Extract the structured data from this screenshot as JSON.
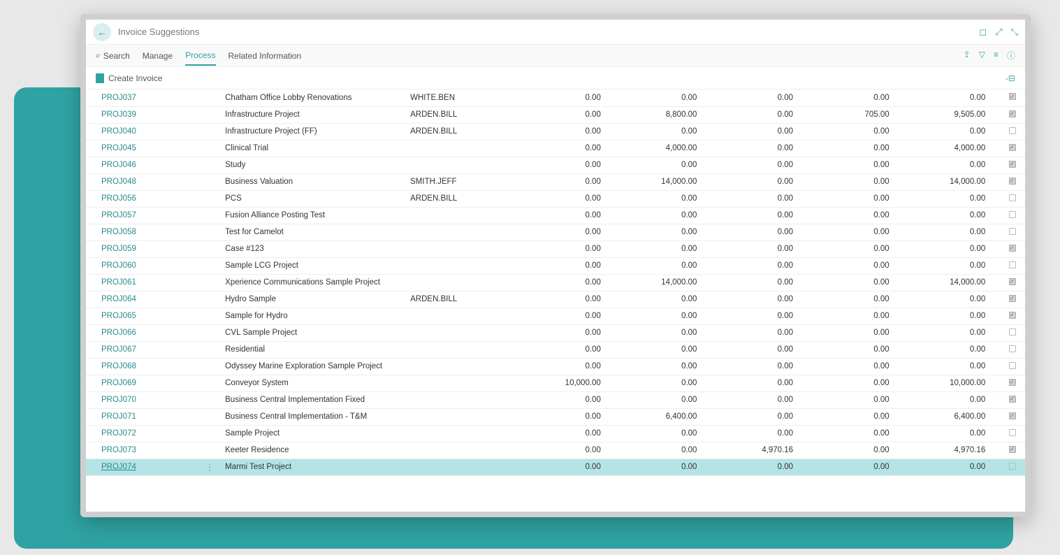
{
  "header": {
    "title": "Invoice Suggestions"
  },
  "menubar": {
    "search": "Search",
    "items": [
      "Manage",
      "Process",
      "Related Information"
    ],
    "active_index": 1
  },
  "actionbar": {
    "create_invoice": "Create Invoice"
  },
  "table": {
    "rows": [
      {
        "proj": "PROJ037",
        "desc": "Chatham Office Lobby Renovations",
        "owner": "WHITE.BEN",
        "c1": "0.00",
        "c2": "0.00",
        "c3": "0.00",
        "c4": "0.00",
        "c5": "0.00",
        "chk": true
      },
      {
        "proj": "PROJ039",
        "desc": "Infrastructure Project",
        "owner": "ARDEN.BILL",
        "c1": "0.00",
        "c2": "8,800.00",
        "c3": "0.00",
        "c4": "705.00",
        "c5": "9,505.00",
        "chk": true
      },
      {
        "proj": "PROJ040",
        "desc": "Infrastructure Project (FF)",
        "owner": "ARDEN.BILL",
        "c1": "0.00",
        "c2": "0.00",
        "c3": "0.00",
        "c4": "0.00",
        "c5": "0.00",
        "chk": false
      },
      {
        "proj": "PROJ045",
        "desc": "Clinical Trial",
        "owner": "",
        "c1": "0.00",
        "c2": "4,000.00",
        "c3": "0.00",
        "c4": "0.00",
        "c5": "4,000.00",
        "chk": true
      },
      {
        "proj": "PROJ046",
        "desc": "Study",
        "owner": "",
        "c1": "0.00",
        "c2": "0.00",
        "c3": "0.00",
        "c4": "0.00",
        "c5": "0.00",
        "chk": true
      },
      {
        "proj": "PROJ048",
        "desc": "Business Valuation",
        "owner": "SMITH.JEFF",
        "c1": "0.00",
        "c2": "14,000.00",
        "c3": "0.00",
        "c4": "0.00",
        "c5": "14,000.00",
        "chk": true
      },
      {
        "proj": "PROJ056",
        "desc": "PCS",
        "owner": "ARDEN.BILL",
        "c1": "0.00",
        "c2": "0.00",
        "c3": "0.00",
        "c4": "0.00",
        "c5": "0.00",
        "chk": false
      },
      {
        "proj": "PROJ057",
        "desc": "Fusion Alliance Posting Test",
        "owner": "",
        "c1": "0.00",
        "c2": "0.00",
        "c3": "0.00",
        "c4": "0.00",
        "c5": "0.00",
        "chk": false
      },
      {
        "proj": "PROJ058",
        "desc": "Test for Camelot",
        "owner": "",
        "c1": "0.00",
        "c2": "0.00",
        "c3": "0.00",
        "c4": "0.00",
        "c5": "0.00",
        "chk": false
      },
      {
        "proj": "PROJ059",
        "desc": "Case #123",
        "owner": "",
        "c1": "0.00",
        "c2": "0.00",
        "c3": "0.00",
        "c4": "0.00",
        "c5": "0.00",
        "chk": true
      },
      {
        "proj": "PROJ060",
        "desc": "Sample LCG Project",
        "owner": "",
        "c1": "0.00",
        "c2": "0.00",
        "c3": "0.00",
        "c4": "0.00",
        "c5": "0.00",
        "chk": false
      },
      {
        "proj": "PROJ061",
        "desc": "Xperience Communications Sample Project",
        "owner": "",
        "c1": "0.00",
        "c2": "14,000.00",
        "c3": "0.00",
        "c4": "0.00",
        "c5": "14,000.00",
        "chk": true
      },
      {
        "proj": "PROJ064",
        "desc": "Hydro Sample",
        "owner": "ARDEN.BILL",
        "c1": "0.00",
        "c2": "0.00",
        "c3": "0.00",
        "c4": "0.00",
        "c5": "0.00",
        "chk": true
      },
      {
        "proj": "PROJ065",
        "desc": "Sample for Hydro",
        "owner": "",
        "c1": "0.00",
        "c2": "0.00",
        "c3": "0.00",
        "c4": "0.00",
        "c5": "0.00",
        "chk": true
      },
      {
        "proj": "PROJ066",
        "desc": "CVL Sample Project",
        "owner": "",
        "c1": "0.00",
        "c2": "0.00",
        "c3": "0.00",
        "c4": "0.00",
        "c5": "0.00",
        "chk": false
      },
      {
        "proj": "PROJ067",
        "desc": "Residential",
        "owner": "",
        "c1": "0.00",
        "c2": "0.00",
        "c3": "0.00",
        "c4": "0.00",
        "c5": "0.00",
        "chk": false
      },
      {
        "proj": "PROJ068",
        "desc": "Odyssey Marine Exploration Sample Project",
        "owner": "",
        "c1": "0.00",
        "c2": "0.00",
        "c3": "0.00",
        "c4": "0.00",
        "c5": "0.00",
        "chk": false
      },
      {
        "proj": "PROJ069",
        "desc": "Conveyor System",
        "owner": "",
        "c1": "10,000.00",
        "c2": "0.00",
        "c3": "0.00",
        "c4": "0.00",
        "c5": "10,000.00",
        "chk": true
      },
      {
        "proj": "PROJ070",
        "desc": "Business Central Implementation Fixed",
        "owner": "",
        "c1": "0.00",
        "c2": "0.00",
        "c3": "0.00",
        "c4": "0.00",
        "c5": "0.00",
        "chk": true
      },
      {
        "proj": "PROJ071",
        "desc": "Business Central Implementation - T&M",
        "owner": "",
        "c1": "0.00",
        "c2": "6,400.00",
        "c3": "0.00",
        "c4": "0.00",
        "c5": "6,400.00",
        "chk": true
      },
      {
        "proj": "PROJ072",
        "desc": "Sample Project",
        "owner": "",
        "c1": "0.00",
        "c2": "0.00",
        "c3": "0.00",
        "c4": "0.00",
        "c5": "0.00",
        "chk": false
      },
      {
        "proj": "PROJ073",
        "desc": "Keeter Residence",
        "owner": "",
        "c1": "0.00",
        "c2": "0.00",
        "c3": "4,970.16",
        "c4": "0.00",
        "c5": "4,970.16",
        "chk": true
      },
      {
        "proj": "PROJ074",
        "desc": "Marmi Test Project",
        "owner": "",
        "c1": "0.00",
        "c2": "0.00",
        "c3": "0.00",
        "c4": "0.00",
        "c5": "0.00",
        "chk": false,
        "selected": true
      }
    ]
  }
}
